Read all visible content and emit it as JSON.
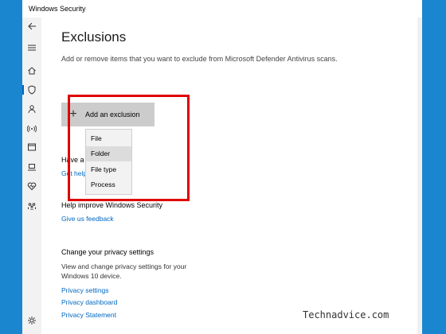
{
  "window": {
    "title": "Windows Security"
  },
  "sidebar": {
    "items": [
      {
        "icon": "back-arrow-icon"
      },
      {
        "icon": "hamburger-menu-icon"
      },
      {
        "icon": "home-icon"
      },
      {
        "icon": "shield-icon",
        "active": true
      },
      {
        "icon": "account-icon"
      },
      {
        "icon": "network-icon"
      },
      {
        "icon": "app-browser-icon"
      },
      {
        "icon": "device-security-icon"
      },
      {
        "icon": "device-health-icon"
      },
      {
        "icon": "family-icon"
      },
      {
        "icon": "settings-gear-icon"
      }
    ]
  },
  "main": {
    "title": "Exclusions",
    "description": "Add or remove items that you want to exclude from Microsoft Defender Antivirus scans.",
    "add_button": {
      "label": "Add an exclusion",
      "icon": "plus-icon"
    },
    "dropdown": {
      "options": [
        "File",
        "Folder",
        "File type",
        "Process"
      ],
      "highlighted": "Folder"
    },
    "partial_heading": "Have a",
    "partial_link": "Get help",
    "improve": {
      "heading": "Help improve Windows Security",
      "link": "Give us feedback"
    },
    "privacy": {
      "heading": "Change your privacy settings",
      "body": "View and change privacy settings for your Windows 10 device.",
      "links": [
        "Privacy settings",
        "Privacy dashboard",
        "Privacy Statement"
      ]
    }
  },
  "watermark": "Technadvice.com",
  "colors": {
    "accent": "#0067c0",
    "highlight_border": "#e00000",
    "background": "#1a86d0"
  }
}
